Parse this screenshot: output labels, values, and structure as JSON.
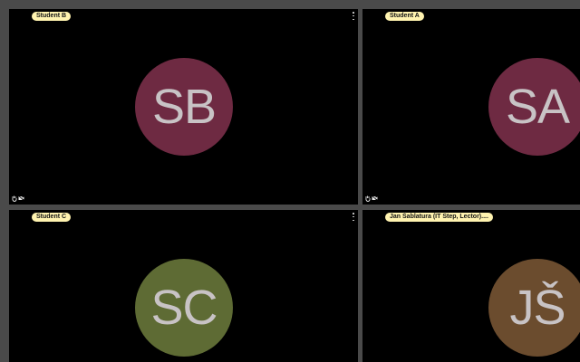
{
  "tiles": [
    {
      "name": "Student B",
      "initials": "SB",
      "avatar_color": "#6e2a42"
    },
    {
      "name": "Student A",
      "initials": "SA",
      "avatar_color": "#6e2a42"
    },
    {
      "name": "Student C",
      "initials": "SC",
      "avatar_color": "#5e6b34"
    },
    {
      "name": "Jan Šablatura (IT Step, Lector)....",
      "initials": "JŠ",
      "avatar_color": "#6b4c2e"
    }
  ],
  "icons": {
    "more": "more-options-icon",
    "hand": "raise-hand-icon",
    "mic": "mic-icon",
    "video_off": "video-off-icon"
  },
  "colors": {
    "background": "#4a4a4a",
    "tile": "#000000",
    "badge": "#fff3b0",
    "initials_text": "#c8c3c5"
  }
}
